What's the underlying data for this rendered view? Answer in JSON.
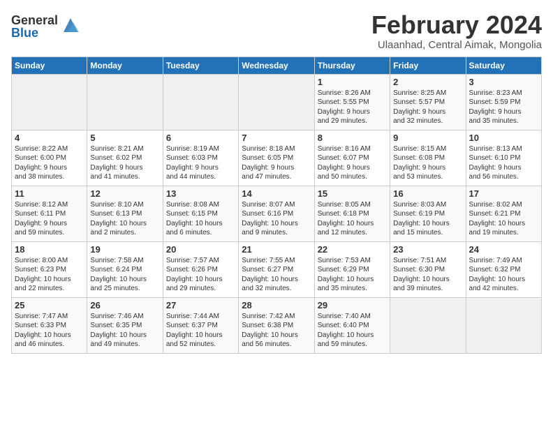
{
  "header": {
    "logo_general": "General",
    "logo_blue": "Blue",
    "month_year": "February 2024",
    "location": "Ulaanhad, Central Aimak, Mongolia"
  },
  "weekdays": [
    "Sunday",
    "Monday",
    "Tuesday",
    "Wednesday",
    "Thursday",
    "Friday",
    "Saturday"
  ],
  "weeks": [
    [
      {
        "day": "",
        "info": ""
      },
      {
        "day": "",
        "info": ""
      },
      {
        "day": "",
        "info": ""
      },
      {
        "day": "",
        "info": ""
      },
      {
        "day": "1",
        "info": "Sunrise: 8:26 AM\nSunset: 5:55 PM\nDaylight: 9 hours\nand 29 minutes."
      },
      {
        "day": "2",
        "info": "Sunrise: 8:25 AM\nSunset: 5:57 PM\nDaylight: 9 hours\nand 32 minutes."
      },
      {
        "day": "3",
        "info": "Sunrise: 8:23 AM\nSunset: 5:59 PM\nDaylight: 9 hours\nand 35 minutes."
      }
    ],
    [
      {
        "day": "4",
        "info": "Sunrise: 8:22 AM\nSunset: 6:00 PM\nDaylight: 9 hours\nand 38 minutes."
      },
      {
        "day": "5",
        "info": "Sunrise: 8:21 AM\nSunset: 6:02 PM\nDaylight: 9 hours\nand 41 minutes."
      },
      {
        "day": "6",
        "info": "Sunrise: 8:19 AM\nSunset: 6:03 PM\nDaylight: 9 hours\nand 44 minutes."
      },
      {
        "day": "7",
        "info": "Sunrise: 8:18 AM\nSunset: 6:05 PM\nDaylight: 9 hours\nand 47 minutes."
      },
      {
        "day": "8",
        "info": "Sunrise: 8:16 AM\nSunset: 6:07 PM\nDaylight: 9 hours\nand 50 minutes."
      },
      {
        "day": "9",
        "info": "Sunrise: 8:15 AM\nSunset: 6:08 PM\nDaylight: 9 hours\nand 53 minutes."
      },
      {
        "day": "10",
        "info": "Sunrise: 8:13 AM\nSunset: 6:10 PM\nDaylight: 9 hours\nand 56 minutes."
      }
    ],
    [
      {
        "day": "11",
        "info": "Sunrise: 8:12 AM\nSunset: 6:11 PM\nDaylight: 9 hours\nand 59 minutes."
      },
      {
        "day": "12",
        "info": "Sunrise: 8:10 AM\nSunset: 6:13 PM\nDaylight: 10 hours\nand 2 minutes."
      },
      {
        "day": "13",
        "info": "Sunrise: 8:08 AM\nSunset: 6:15 PM\nDaylight: 10 hours\nand 6 minutes."
      },
      {
        "day": "14",
        "info": "Sunrise: 8:07 AM\nSunset: 6:16 PM\nDaylight: 10 hours\nand 9 minutes."
      },
      {
        "day": "15",
        "info": "Sunrise: 8:05 AM\nSunset: 6:18 PM\nDaylight: 10 hours\nand 12 minutes."
      },
      {
        "day": "16",
        "info": "Sunrise: 8:03 AM\nSunset: 6:19 PM\nDaylight: 10 hours\nand 15 minutes."
      },
      {
        "day": "17",
        "info": "Sunrise: 8:02 AM\nSunset: 6:21 PM\nDaylight: 10 hours\nand 19 minutes."
      }
    ],
    [
      {
        "day": "18",
        "info": "Sunrise: 8:00 AM\nSunset: 6:23 PM\nDaylight: 10 hours\nand 22 minutes."
      },
      {
        "day": "19",
        "info": "Sunrise: 7:58 AM\nSunset: 6:24 PM\nDaylight: 10 hours\nand 25 minutes."
      },
      {
        "day": "20",
        "info": "Sunrise: 7:57 AM\nSunset: 6:26 PM\nDaylight: 10 hours\nand 29 minutes."
      },
      {
        "day": "21",
        "info": "Sunrise: 7:55 AM\nSunset: 6:27 PM\nDaylight: 10 hours\nand 32 minutes."
      },
      {
        "day": "22",
        "info": "Sunrise: 7:53 AM\nSunset: 6:29 PM\nDaylight: 10 hours\nand 35 minutes."
      },
      {
        "day": "23",
        "info": "Sunrise: 7:51 AM\nSunset: 6:30 PM\nDaylight: 10 hours\nand 39 minutes."
      },
      {
        "day": "24",
        "info": "Sunrise: 7:49 AM\nSunset: 6:32 PM\nDaylight: 10 hours\nand 42 minutes."
      }
    ],
    [
      {
        "day": "25",
        "info": "Sunrise: 7:47 AM\nSunset: 6:33 PM\nDaylight: 10 hours\nand 46 minutes."
      },
      {
        "day": "26",
        "info": "Sunrise: 7:46 AM\nSunset: 6:35 PM\nDaylight: 10 hours\nand 49 minutes."
      },
      {
        "day": "27",
        "info": "Sunrise: 7:44 AM\nSunset: 6:37 PM\nDaylight: 10 hours\nand 52 minutes."
      },
      {
        "day": "28",
        "info": "Sunrise: 7:42 AM\nSunset: 6:38 PM\nDaylight: 10 hours\nand 56 minutes."
      },
      {
        "day": "29",
        "info": "Sunrise: 7:40 AM\nSunset: 6:40 PM\nDaylight: 10 hours\nand 59 minutes."
      },
      {
        "day": "",
        "info": ""
      },
      {
        "day": "",
        "info": ""
      }
    ]
  ]
}
